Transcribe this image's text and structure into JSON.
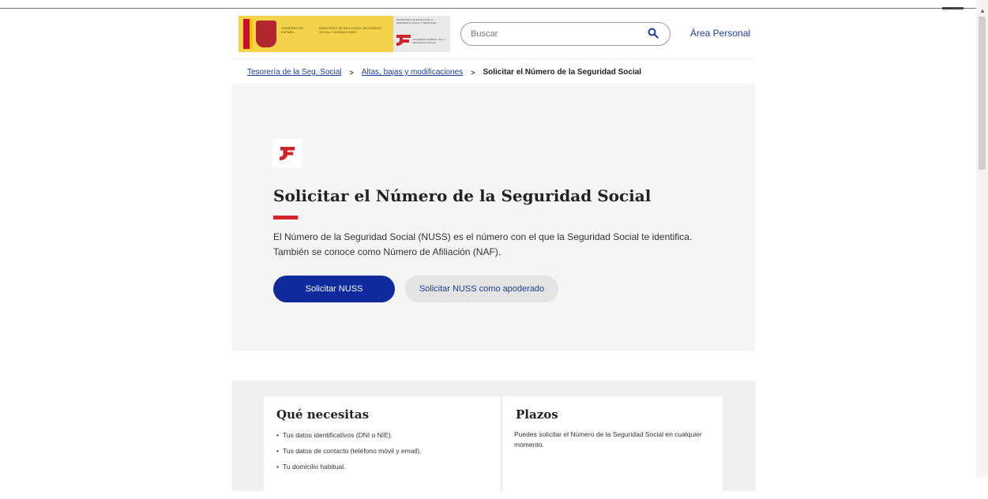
{
  "header": {
    "logo_gobierno_text": "GOBIERNO DE ESPAÑA",
    "logo_ministerio_text": "MINISTERIO DE INCLUSIÓN, SEGURIDAD SOCIAL Y MIGRACIONES",
    "logo_secretaria_text": "SECRETARÍA DE ESTADO DE LA SEGURIDAD SOCIAL Y PENSIONES",
    "logo_tgss_text": "TESORERÍA GENERAL DE LA SEGURIDAD SOCIAL",
    "search_placeholder": "Buscar",
    "area_personal": "Área Personal"
  },
  "breadcrumb": {
    "items": [
      "Tesorería de la Seg. Social",
      "Altas, bajas y modificaciones",
      "Solicitar el Número de la Seguridad Social"
    ],
    "separator": ">"
  },
  "hero": {
    "title": "Solicitar el Número de la Seguridad Social",
    "description": "El Número de la Seguridad Social (NUSS) es el número con el que la Seguridad Social te identifica. También se conoce como Número de Afiliación (NAF).",
    "primary_button": "Solicitar NUSS",
    "secondary_button": "Solicitar NUSS como apoderado"
  },
  "info": {
    "needs_title": "Qué necesitas",
    "needs_items": [
      "Tus datos identificativos (DNI o NIE).",
      "Tus datos de contacto (teléfono móvil y email).",
      "Tu domicilio habitual."
    ],
    "deadlines_title": "Plazos",
    "deadlines_text": "Puedes solicitar el Número de la Seguridad Social en cualquier momento."
  },
  "colors": {
    "brand_red": "#d1242b",
    "primary_blue": "#0e2a9c",
    "link_blue": "#1d3f99"
  }
}
